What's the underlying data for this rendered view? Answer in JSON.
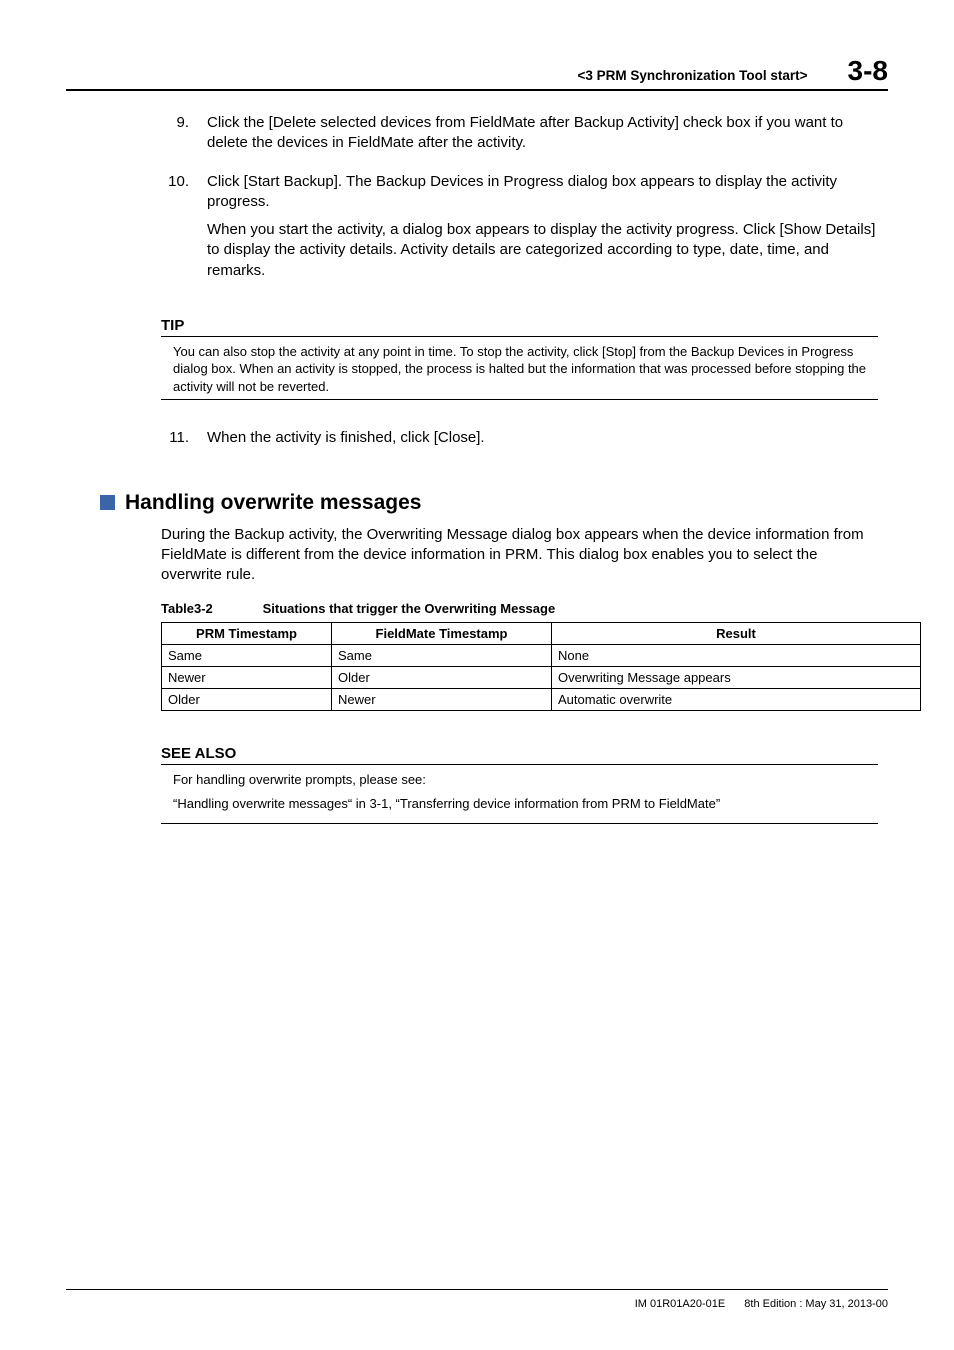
{
  "header": {
    "title": "<3  PRM Synchronization Tool start>",
    "page_number": "3-8"
  },
  "steps": [
    {
      "num": "9.",
      "paras": [
        "Click the [Delete selected devices from FieldMate after Backup Activity] check box if you want to delete the devices in FieldMate after the activity."
      ]
    },
    {
      "num": "10.",
      "paras": [
        "Click [Start Backup]. The Backup Devices in Progress dialog box appears to display the activity progress.",
        "When you start the activity, a dialog box appears to display the activity progress. Click [Show Details] to display the activity details. Activity details are categorized according to type, date, time, and remarks."
      ]
    }
  ],
  "tip": {
    "label": "TIP",
    "body": "You can also stop the activity at any point in time. To stop the activity, click [Stop] from the Backup Devices in Progress dialog box. When an activity is stopped, the process is halted but the information that was processed before stopping the activity will not be reverted."
  },
  "steps2": [
    {
      "num": "11.",
      "paras": [
        "When the activity is finished, click [Close]."
      ]
    }
  ],
  "section": {
    "title": "Handling overwrite messages",
    "para": "During the Backup activity, the Overwriting Message dialog box appears when the device information from FieldMate is different from the device information in PRM. This dialog box enables you to select the overwrite rule."
  },
  "table": {
    "caption_id": "Table3-2",
    "caption_text": "Situations that trigger the Overwriting Message",
    "headers": [
      "PRM Timestamp",
      "FieldMate Timestamp",
      "Result"
    ],
    "rows": [
      [
        "Same",
        "Same",
        "None"
      ],
      [
        "Newer",
        "Older",
        "Overwriting Message appears"
      ],
      [
        "Older",
        "Newer",
        "Automatic overwrite"
      ]
    ]
  },
  "see_also": {
    "label": "SEE ALSO",
    "lines": [
      "For handling overwrite prompts, please see:",
      "“Handling overwrite messages“ in 3-1, “Transferring device information from PRM to FieldMate”"
    ]
  },
  "footer": {
    "doc_id": "IM 01R01A20-01E",
    "edition": "8th Edition : May 31, 2013-00"
  }
}
